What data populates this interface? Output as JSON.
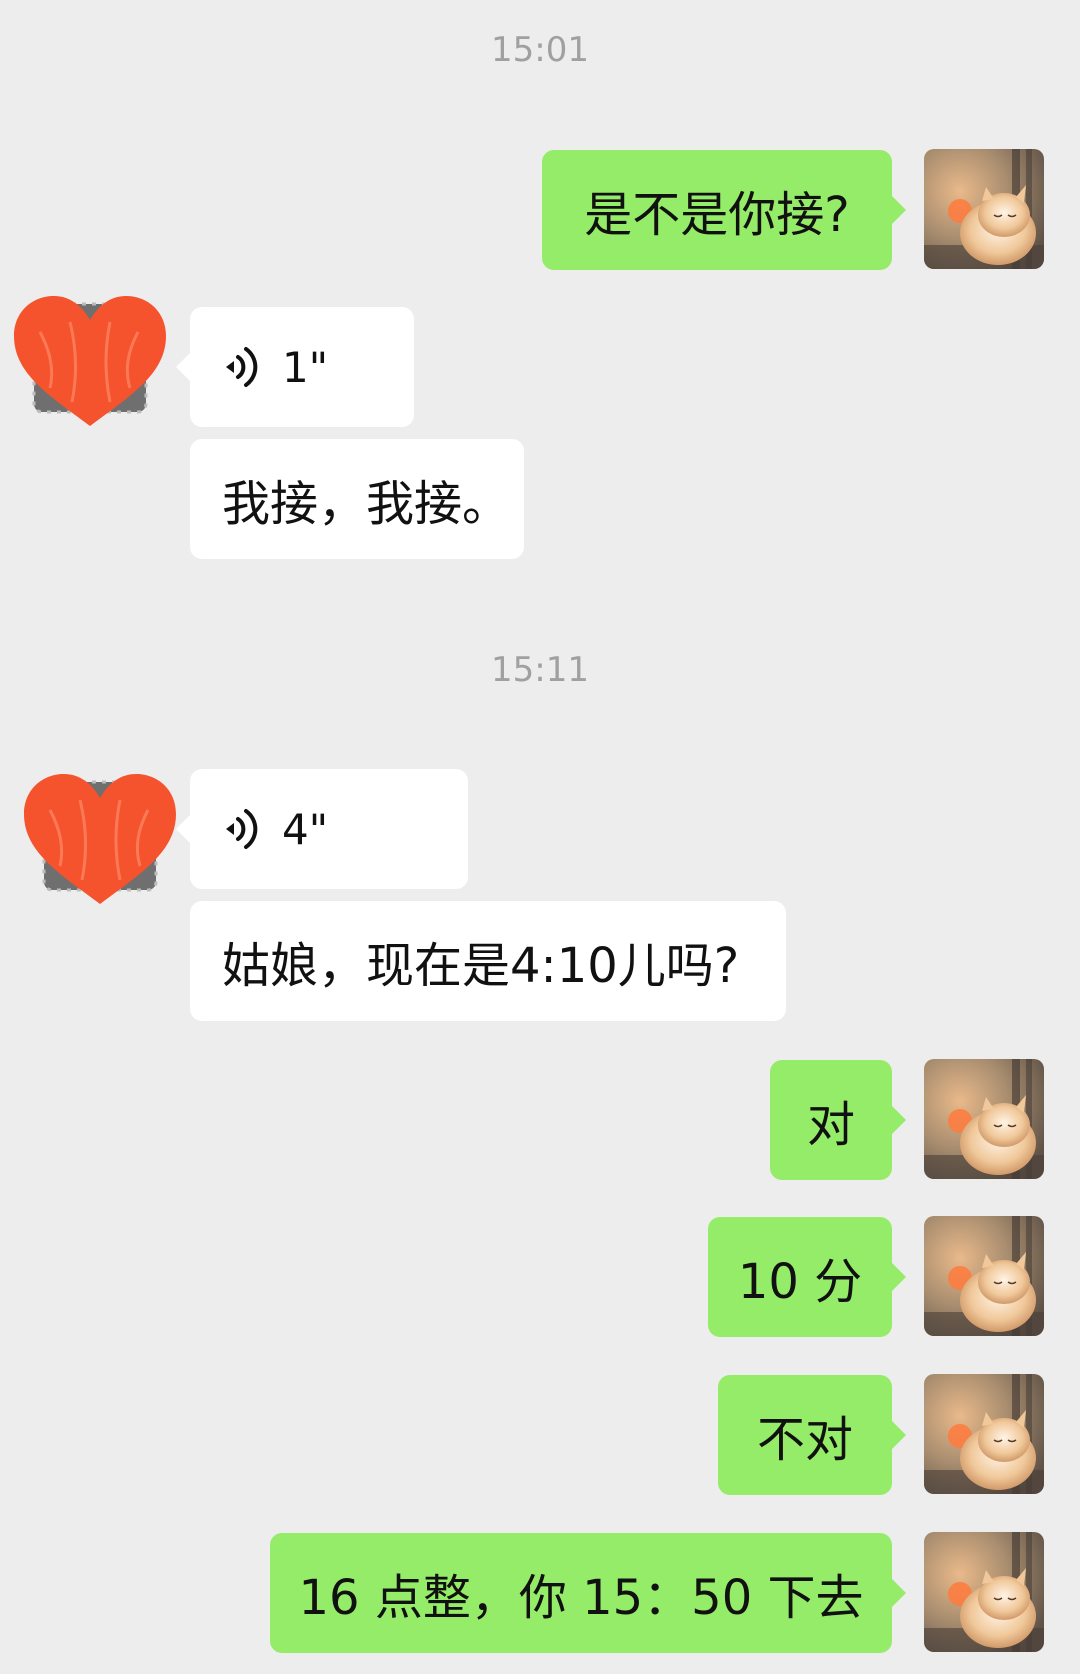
{
  "timestamps": [
    "15:01",
    "15:11"
  ],
  "messages": [
    {
      "text": "是不是你接?"
    },
    {
      "voice_duration": "1\""
    },
    {
      "text": "我接，我接。"
    },
    {
      "voice_duration": "4\""
    },
    {
      "text": "姑娘，现在是4:10儿吗?"
    },
    {
      "text": "对"
    },
    {
      "text": "10 分"
    },
    {
      "text": "不对"
    },
    {
      "text": "16 点整，你 15：50 下去"
    }
  ],
  "icons": {
    "self_avatar": "cat-avatar-icon",
    "other_avatar": "heart-scribble-avatar-icon",
    "voice": "voice-wave-icon"
  },
  "colors": {
    "background": "#ededed",
    "outgoing_bubble": "#95ec69",
    "incoming_bubble": "#ffffff",
    "heart": "#f4532d",
    "timestamp": "#a0a0a0"
  }
}
